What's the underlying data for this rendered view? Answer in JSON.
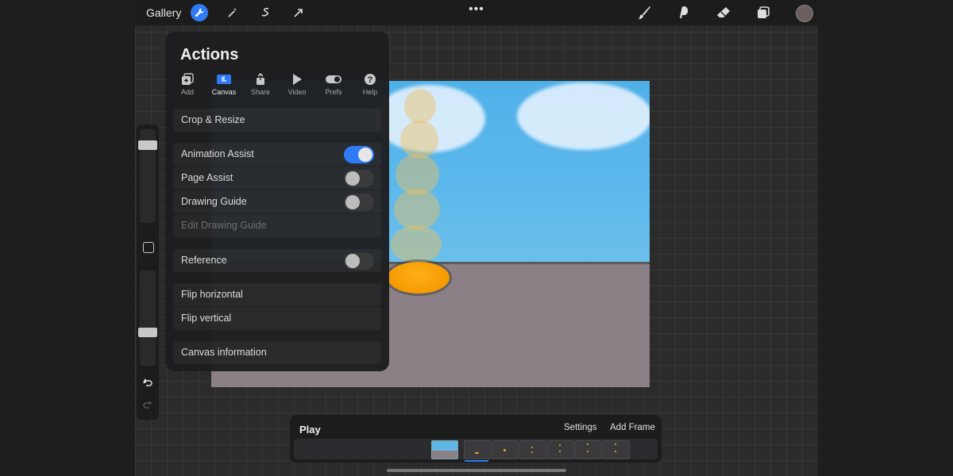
{
  "topbar": {
    "gallery_label": "Gallery",
    "more_label": "•••",
    "tools_left": [
      "wrench-icon",
      "magic-wand-icon",
      "selection-icon",
      "transform-arrow-icon"
    ],
    "tools_right": [
      "brush-icon",
      "smudge-icon",
      "eraser-icon",
      "layers-icon"
    ],
    "color": "#6b5e5e",
    "accent": "#2f7bf5"
  },
  "actions": {
    "title": "Actions",
    "tabs": [
      {
        "label": "Add",
        "icon": "add-icon"
      },
      {
        "label": "Canvas",
        "icon": "canvas-icon",
        "active": true
      },
      {
        "label": "Share",
        "icon": "share-icon"
      },
      {
        "label": "Video",
        "icon": "video-play-icon"
      },
      {
        "label": "Prefs",
        "icon": "toggle-prefs-icon"
      },
      {
        "label": "Help",
        "icon": "help-icon"
      }
    ],
    "items": {
      "crop_resize": "Crop & Resize",
      "animation_assist": {
        "label": "Animation Assist",
        "on": true
      },
      "page_assist": {
        "label": "Page Assist",
        "on": false
      },
      "drawing_guide": {
        "label": "Drawing Guide",
        "on": false
      },
      "edit_drawing_guide": "Edit Drawing Guide",
      "reference": {
        "label": "Reference",
        "on": false
      },
      "flip_horizontal": "Flip horizontal",
      "flip_vertical": "Flip vertical",
      "canvas_information": "Canvas information"
    }
  },
  "animation_bar": {
    "play_label": "Play",
    "settings_label": "Settings",
    "add_frame_label": "Add Frame",
    "frame_count": 8
  }
}
